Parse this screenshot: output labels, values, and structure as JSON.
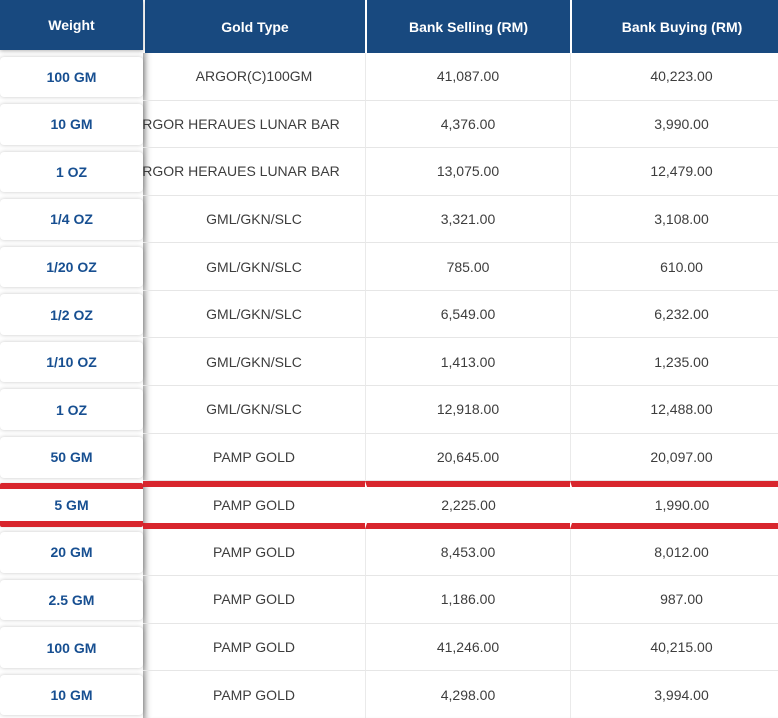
{
  "colors": {
    "header_bg": "#18497f",
    "header_text": "#ffffff",
    "weight_text": "#174f91",
    "cell_text": "#3d3d3d",
    "row_border": "#e6e6e6",
    "highlight_border": "#d8262d"
  },
  "table": {
    "columns": [
      {
        "id": "weight",
        "label": "Weight"
      },
      {
        "id": "gold_type",
        "label": "Gold Type"
      },
      {
        "id": "bank_selling",
        "label": "Bank Selling (RM)"
      },
      {
        "id": "bank_buying",
        "label": "Bank Buying (RM)"
      }
    ],
    "rows": [
      {
        "weight": "100 GM",
        "gold_type": "ARGOR(C)100GM",
        "bank_selling": "41,087.00",
        "bank_buying": "40,223.00",
        "highlighted": false,
        "gold_type_clipped": false
      },
      {
        "weight": "10 GM",
        "gold_type": "RGOR HERAUES LUNAR BAR",
        "bank_selling": "4,376.00",
        "bank_buying": "3,990.00",
        "highlighted": false,
        "gold_type_clipped": true
      },
      {
        "weight": "1 OZ",
        "gold_type": "RGOR HERAUES LUNAR BAR",
        "bank_selling": "13,075.00",
        "bank_buying": "12,479.00",
        "highlighted": false,
        "gold_type_clipped": true
      },
      {
        "weight": "1/4 OZ",
        "gold_type": "GML/GKN/SLC",
        "bank_selling": "3,321.00",
        "bank_buying": "3,108.00",
        "highlighted": false,
        "gold_type_clipped": false
      },
      {
        "weight": "1/20 OZ",
        "gold_type": "GML/GKN/SLC",
        "bank_selling": "785.00",
        "bank_buying": "610.00",
        "highlighted": false,
        "gold_type_clipped": false
      },
      {
        "weight": "1/2 OZ",
        "gold_type": "GML/GKN/SLC",
        "bank_selling": "6,549.00",
        "bank_buying": "6,232.00",
        "highlighted": false,
        "gold_type_clipped": false
      },
      {
        "weight": "1/10 OZ",
        "gold_type": "GML/GKN/SLC",
        "bank_selling": "1,413.00",
        "bank_buying": "1,235.00",
        "highlighted": false,
        "gold_type_clipped": false
      },
      {
        "weight": "1 OZ",
        "gold_type": "GML/GKN/SLC",
        "bank_selling": "12,918.00",
        "bank_buying": "12,488.00",
        "highlighted": false,
        "gold_type_clipped": false
      },
      {
        "weight": "50 GM",
        "gold_type": "PAMP GOLD",
        "bank_selling": "20,645.00",
        "bank_buying": "20,097.00",
        "highlighted": false,
        "gold_type_clipped": false
      },
      {
        "weight": "5 GM",
        "gold_type": "PAMP GOLD",
        "bank_selling": "2,225.00",
        "bank_buying": "1,990.00",
        "highlighted": true,
        "gold_type_clipped": false
      },
      {
        "weight": "20 GM",
        "gold_type": "PAMP GOLD",
        "bank_selling": "8,453.00",
        "bank_buying": "8,012.00",
        "highlighted": false,
        "gold_type_clipped": false
      },
      {
        "weight": "2.5 GM",
        "gold_type": "PAMP GOLD",
        "bank_selling": "1,186.00",
        "bank_buying": "987.00",
        "highlighted": false,
        "gold_type_clipped": false
      },
      {
        "weight": "100 GM",
        "gold_type": "PAMP GOLD",
        "bank_selling": "41,246.00",
        "bank_buying": "40,215.00",
        "highlighted": false,
        "gold_type_clipped": false
      },
      {
        "weight": "10 GM",
        "gold_type": "PAMP GOLD",
        "bank_selling": "4,298.00",
        "bank_buying": "3,994.00",
        "highlighted": false,
        "gold_type_clipped": false
      }
    ]
  }
}
